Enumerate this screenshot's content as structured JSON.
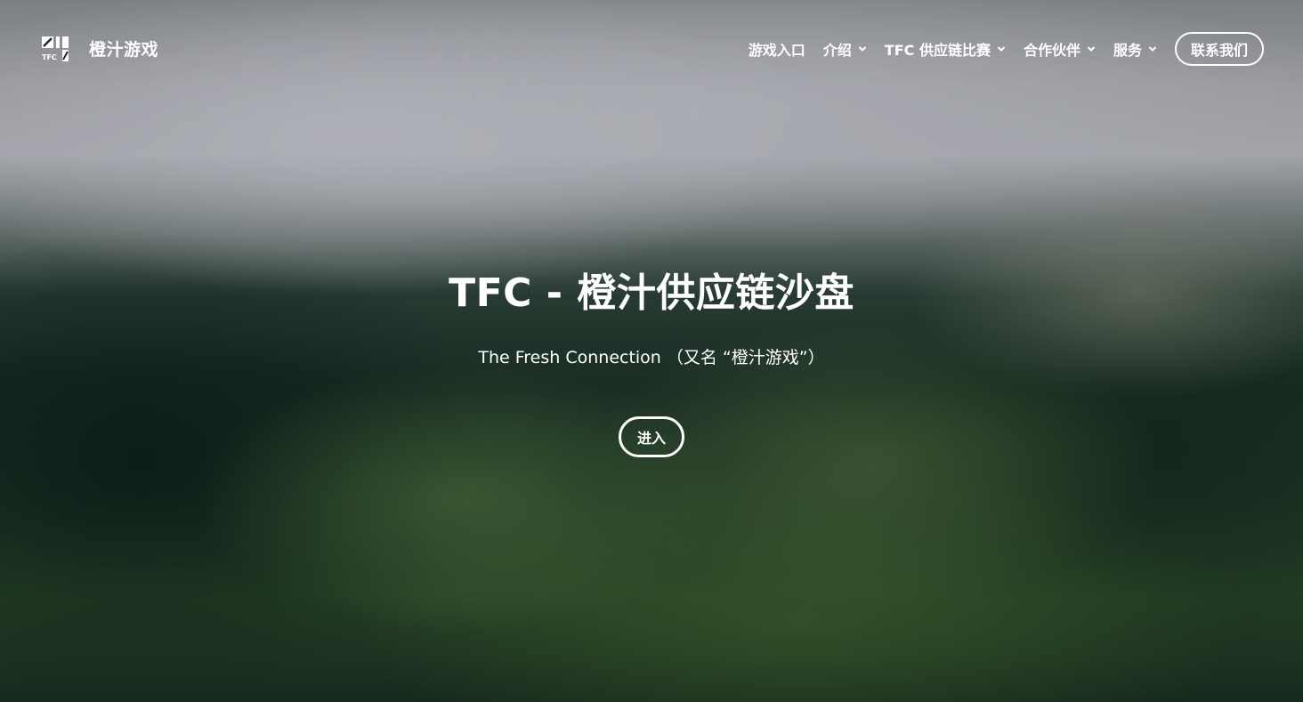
{
  "brand": {
    "logo_text": "TFC",
    "name": "橙汁游戏"
  },
  "nav": {
    "items": [
      {
        "label": "游戏入口",
        "has_dropdown": false
      },
      {
        "label": "介绍",
        "has_dropdown": true
      },
      {
        "label": "TFC 供应链比赛",
        "has_dropdown": true
      },
      {
        "label": "合作伙伴",
        "has_dropdown": true
      },
      {
        "label": "服务",
        "has_dropdown": true
      }
    ],
    "contact_label": "联系我们"
  },
  "hero": {
    "title": "TFC - 橙汁供应链沙盘",
    "subtitle": "The Fresh Connection （又名 “橙汁游戏”）",
    "button_label": "进入"
  },
  "colors": {
    "text": "#ffffff",
    "background_dark": "#1c2a22"
  }
}
